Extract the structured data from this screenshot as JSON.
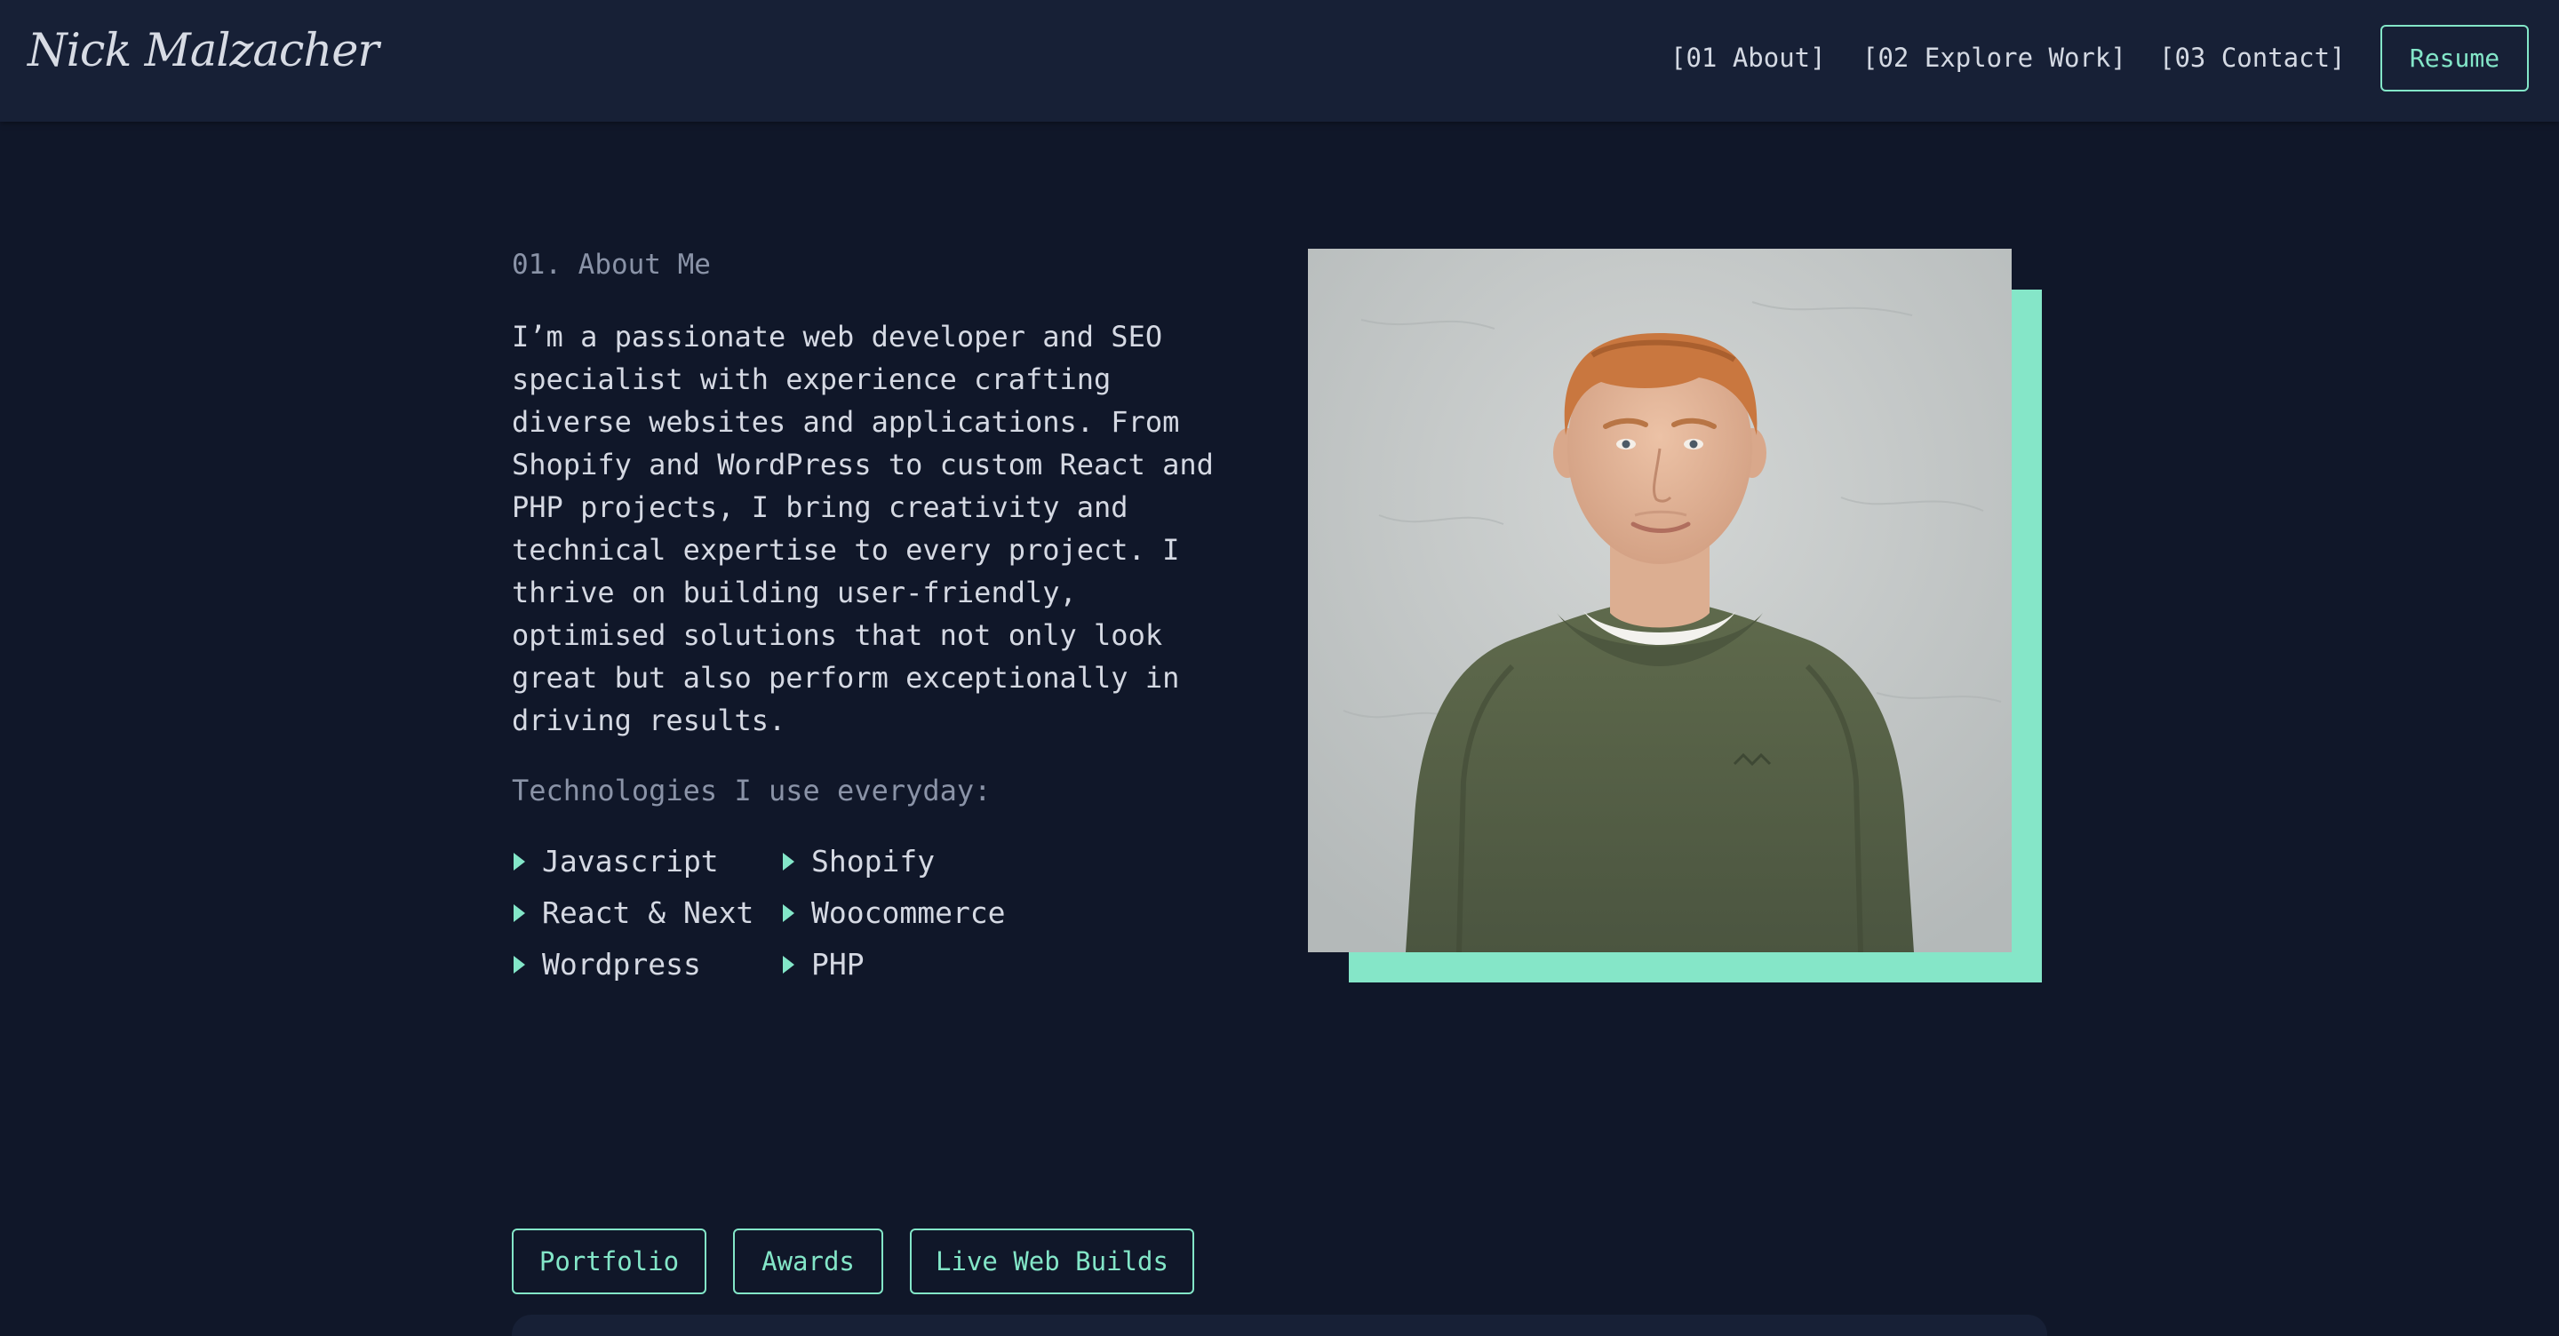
{
  "header": {
    "logo": "Nick Malzacher",
    "nav": [
      "[01 About]",
      "[02 Explore Work]",
      "[03 Contact]"
    ],
    "resume_label": "Resume"
  },
  "about": {
    "heading": "01. About Me",
    "bio": "I’m a passionate web developer and SEO specialist with experience crafting diverse websites and applications. From Shopify and WordPress to custom React and PHP projects, I bring creativity and technical expertise to every project. I thrive on building user-friendly, optimised solutions that not only look great but also perform exceptionally in driving results.",
    "tech_heading": "Technologies I use everyday:",
    "technologies": [
      "Javascript",
      "Shopify",
      "React & Next",
      "Woocommerce",
      "Wordpress",
      "PHP"
    ]
  },
  "tabs": [
    "Portfolio",
    "Awards",
    "Live Web Builds"
  ],
  "colors": {
    "accent": "#83e6c8",
    "background": "#101729",
    "header_background": "#172036",
    "text": "#d5d9e3",
    "muted_text": "#8a93a7"
  }
}
